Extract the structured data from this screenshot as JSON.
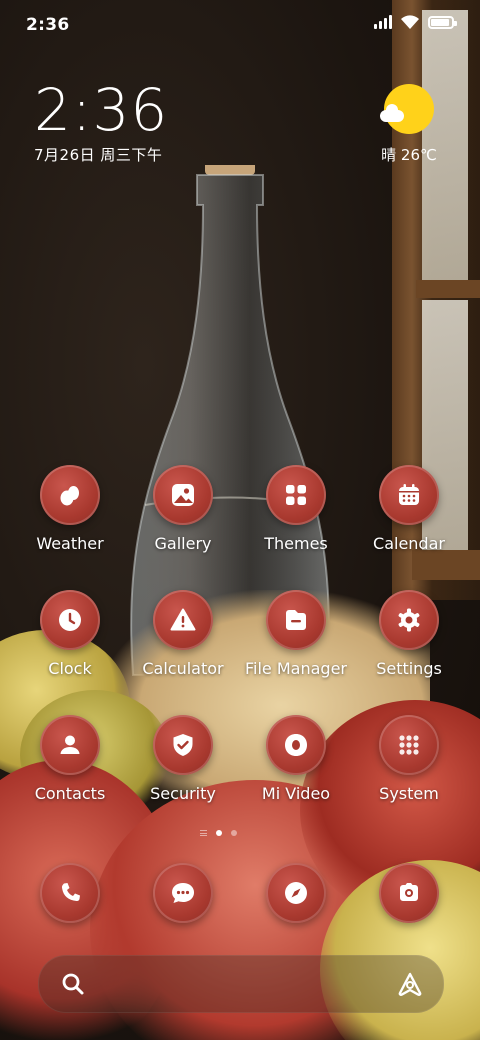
{
  "status_bar": {
    "time": "2:36",
    "icons": [
      "signal-icon",
      "wifi-icon",
      "battery-icon"
    ],
    "battery_level": 0.9
  },
  "clock_widget": {
    "time": "2:36",
    "date": "7月26日 周三下午"
  },
  "weather_widget": {
    "icon": "partly-sunny-icon",
    "condition_temp": "晴 26℃"
  },
  "apps": [
    {
      "label": "Weather",
      "icon": "weather-icon"
    },
    {
      "label": "Gallery",
      "icon": "gallery-icon"
    },
    {
      "label": "Themes",
      "icon": "themes-icon"
    },
    {
      "label": "Calendar",
      "icon": "calendar-icon"
    },
    {
      "label": "Clock",
      "icon": "clock-icon"
    },
    {
      "label": "Calculator",
      "icon": "calculator-icon"
    },
    {
      "label": "File Manager",
      "icon": "file-manager-icon"
    },
    {
      "label": "Settings",
      "icon": "settings-icon"
    },
    {
      "label": "Contacts",
      "icon": "contacts-icon"
    },
    {
      "label": "Security",
      "icon": "security-icon"
    },
    {
      "label": "Mi Video",
      "icon": "mi-video-icon"
    },
    {
      "label": "System",
      "icon": "system-folder-icon"
    }
  ],
  "page_indicator": {
    "pages": 2,
    "active": 1
  },
  "dock": [
    {
      "icon": "phone-icon"
    },
    {
      "icon": "messages-icon"
    },
    {
      "icon": "browser-icon"
    },
    {
      "icon": "camera-icon"
    }
  ],
  "search_bar": {
    "left_icon": "search-icon",
    "right_icon": "assistant-icon"
  },
  "colors": {
    "app_icon_bg": "#a9392f",
    "weather_sun": "#ffd21a"
  }
}
